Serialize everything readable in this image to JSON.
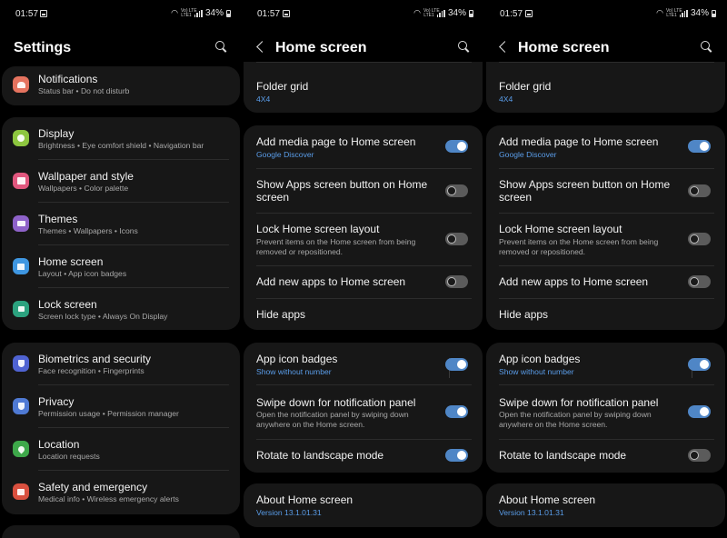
{
  "status": {
    "time": "01:57",
    "battery": "34%",
    "network": "Vo) LTE\nLTE1"
  },
  "colors": {
    "accent": "#4f86c6",
    "link": "#5a9de9",
    "card": "#171717"
  },
  "settings": {
    "title": "Settings",
    "items": [
      {
        "title": "Notifications",
        "sub": "Status bar  •  Do not disturb",
        "icon": "bell-icon",
        "color": "#e5735f"
      },
      {
        "title": "Display",
        "sub": "Brightness  •  Eye comfort shield  •  Navigation bar",
        "icon": "sun-icon",
        "color": "#8dc63f"
      },
      {
        "title": "Wallpaper and style",
        "sub": "Wallpapers  •  Color palette",
        "icon": "image-icon",
        "color": "#e1577e"
      },
      {
        "title": "Themes",
        "sub": "Themes  •  Wallpapers  •  Icons",
        "icon": "brush-icon",
        "color": "#8e62c9"
      },
      {
        "title": "Home screen",
        "sub": "Layout  •  App icon badges",
        "icon": "home-icon",
        "color": "#3f97e2"
      },
      {
        "title": "Lock screen",
        "sub": "Screen lock type  •  Always On Display",
        "icon": "lock-icon",
        "color": "#2ca27f"
      },
      {
        "title": "Biometrics and security",
        "sub": "Face recognition  •  Fingerprints",
        "icon": "shield-icon",
        "color": "#4f63d2"
      },
      {
        "title": "Privacy",
        "sub": "Permission usage  •  Permission manager",
        "icon": "privacy-shield-icon",
        "color": "#4f7ad4"
      },
      {
        "title": "Location",
        "sub": "Location requests",
        "icon": "location-pin-icon",
        "color": "#3ea84a"
      },
      {
        "title": "Safety and emergency",
        "sub": "Medical info  •  Wireless emergency alerts",
        "icon": "alert-icon",
        "color": "#d9503f"
      }
    ]
  },
  "home_screens": [
    {
      "title": "Home screen",
      "folder_grid": {
        "title": "Folder grid",
        "sub": "4X4"
      },
      "group1": [
        {
          "title": "Add media page to Home screen",
          "sub": "Google Discover",
          "toggle": true
        },
        {
          "title": "Show Apps screen button on Home",
          "title2": "screen",
          "toggle": false
        },
        {
          "title": "Lock Home screen layout",
          "sub": "Prevent items on the Home screen from being",
          "sub2": "removed or repositioned.",
          "toggle": false
        },
        {
          "title": "Add new apps to Home screen",
          "toggle": false
        },
        {
          "title": "Hide apps"
        }
      ],
      "group2": [
        {
          "title": "App icon badges",
          "sub": "Show without number",
          "toggle": true
        },
        {
          "title": "Swipe down for notification panel",
          "sub": "Open the notification panel by swiping down",
          "sub2": "anywhere on the Home screen.",
          "toggle": true
        },
        {
          "title": "Rotate to landscape mode",
          "toggle": true
        }
      ],
      "about": {
        "title": "About Home screen",
        "sub": "Version 13.1.01.31"
      }
    },
    {
      "title": "Home screen",
      "folder_grid": {
        "title": "Folder grid",
        "sub": "4X4"
      },
      "group1": [
        {
          "title": "Add media page to Home screen",
          "sub": "Google Discover",
          "toggle": true
        },
        {
          "title": "Show Apps screen button on Home",
          "title2": "screen",
          "toggle": false
        },
        {
          "title": "Lock Home screen layout",
          "sub": "Prevent items on the Home screen from being",
          "sub2": "removed or repositioned.",
          "toggle": false
        },
        {
          "title": "Add new apps to Home screen",
          "toggle": false
        },
        {
          "title": "Hide apps"
        }
      ],
      "group2": [
        {
          "title": "App icon badges",
          "sub": "Show without number",
          "toggle": true
        },
        {
          "title": "Swipe down for notification panel",
          "sub": "Open the notification panel by swiping down",
          "sub2": "anywhere on the Home screen.",
          "toggle": true
        },
        {
          "title": "Rotate to landscape mode",
          "toggle": false
        }
      ],
      "about": {
        "title": "About Home screen",
        "sub": "Version 13.1.01.31"
      }
    }
  ]
}
